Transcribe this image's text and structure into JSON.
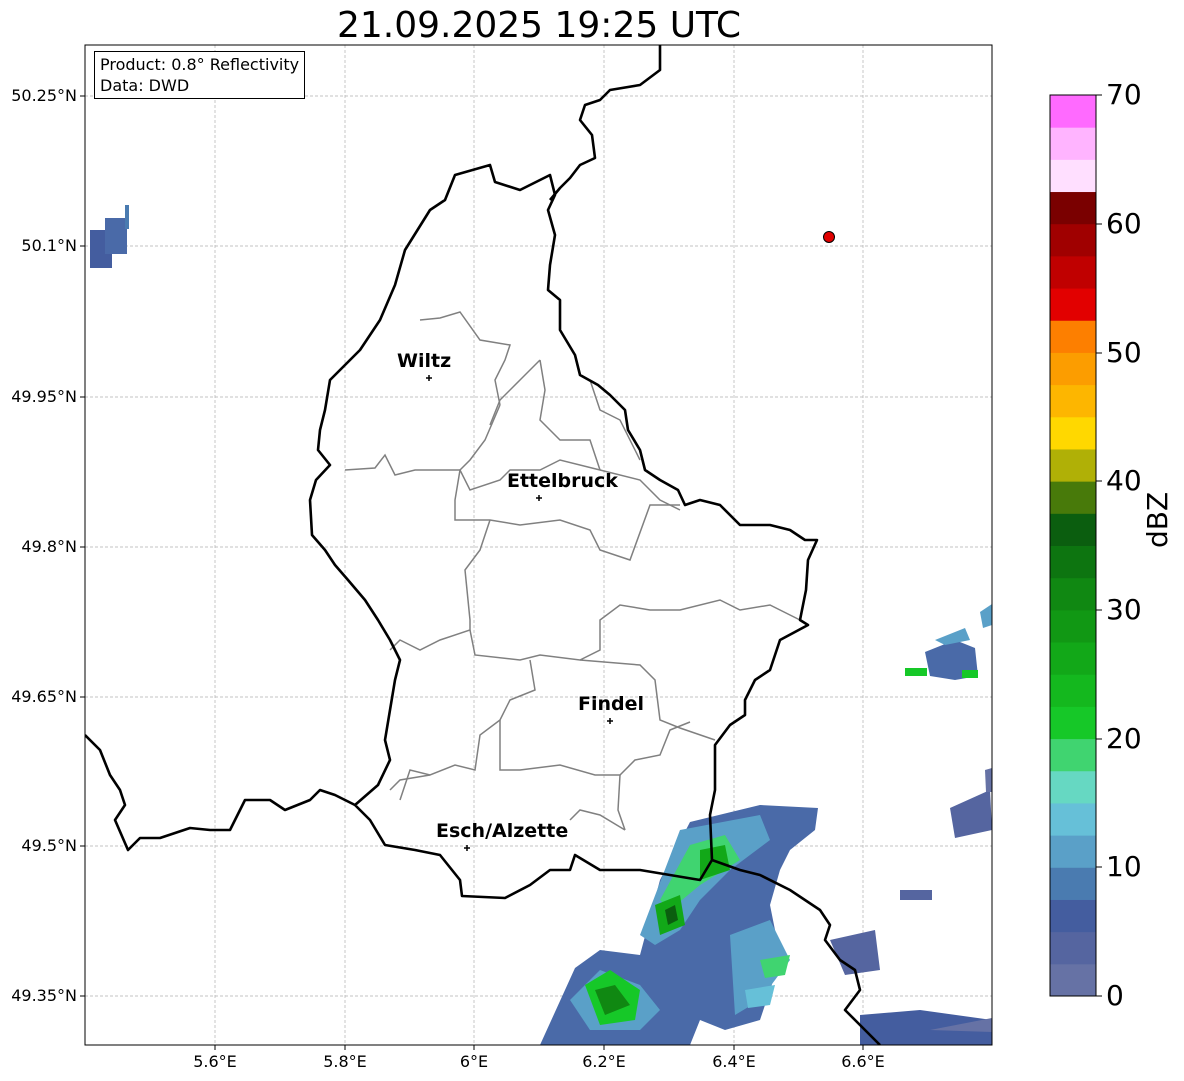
{
  "title": "21.09.2025 19:25 UTC",
  "info": {
    "product": "Product: 0.8° Reflectivity",
    "data": "Data: DWD"
  },
  "axes": {
    "lon_labels": [
      "5.6°E",
      "5.8°E",
      "6°E",
      "6.2°E",
      "6.4°E",
      "6.6°E"
    ],
    "lat_labels": [
      "50.25°N",
      "50.1°N",
      "49.95°N",
      "49.8°N",
      "49.65°N",
      "49.5°N",
      "49.35°N"
    ],
    "lon_range": [
      5.4,
      6.8
    ],
    "lat_range": [
      49.3,
      50.3
    ],
    "grid": true
  },
  "colorbar": {
    "label": "dBZ",
    "ticks": [
      "0",
      "10",
      "20",
      "30",
      "40",
      "50",
      "60",
      "70"
    ],
    "range": [
      0,
      70
    ],
    "step": 2.5,
    "colors": [
      "#6672a5",
      "#5565a0",
      "#445d9f",
      "#4a7bb0",
      "#5aa0c8",
      "#66c0d8",
      "#66d8c2",
      "#40d470",
      "#16c828",
      "#14b81e",
      "#12a818",
      "#119814",
      "#108812",
      "#0d7510",
      "#0b5e0f",
      "#487a0a",
      "#b0b006",
      "#ffd800",
      "#fdb600",
      "#fc9d00",
      "#fd7f00",
      "#e20000",
      "#c00000",
      "#a00000",
      "#7a0000",
      "#ffdfff",
      "#ffb4ff",
      "#ff6aff",
      "#ea36ea"
    ]
  },
  "cities": [
    {
      "name": "Wiltz"
    },
    {
      "name": "Ettelbruck"
    },
    {
      "name": "Findel"
    },
    {
      "name": "Esch/Alzette"
    }
  ],
  "radar_marker": {
    "color": "#e00000",
    "lon": 6.55,
    "lat": 50.11
  }
}
